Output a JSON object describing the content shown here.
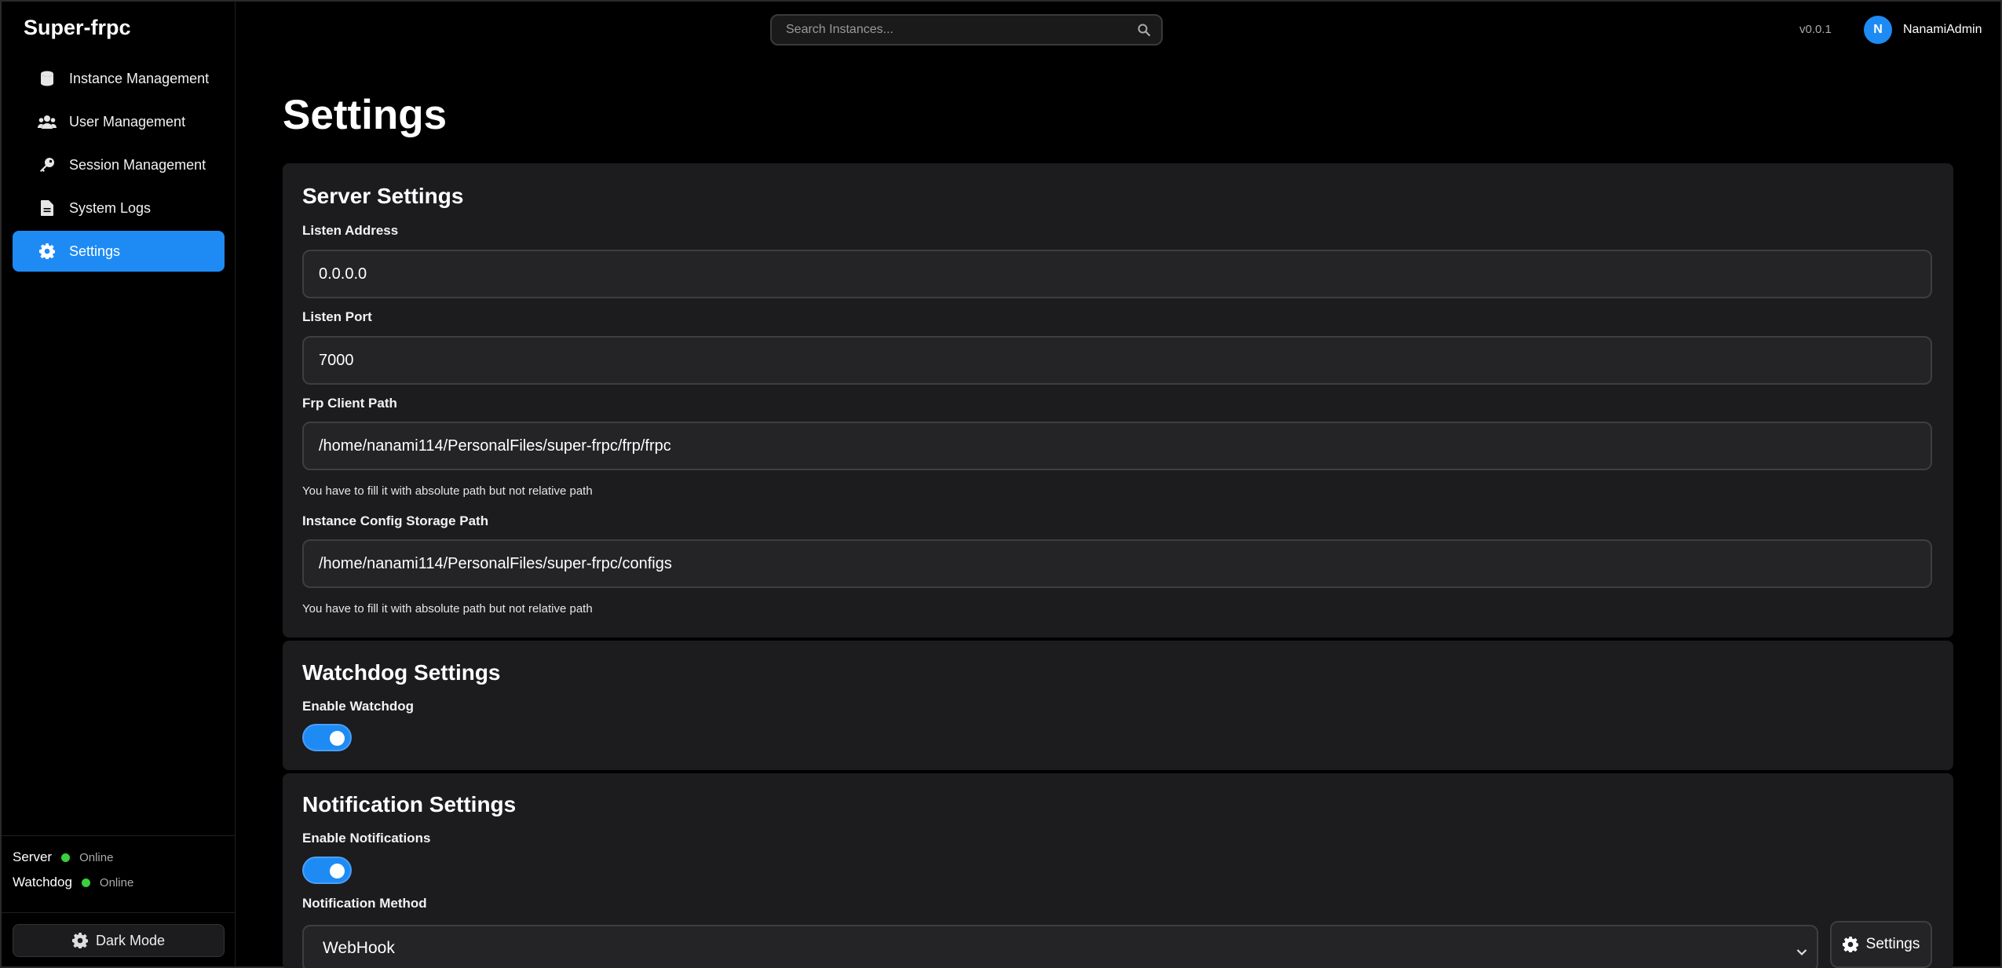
{
  "brand": "Super-frpc",
  "sidebar": {
    "items": [
      {
        "label": "Instance Management",
        "icon": "database-icon"
      },
      {
        "label": "User Management",
        "icon": "users-icon"
      },
      {
        "label": "Session Management",
        "icon": "key-icon"
      },
      {
        "label": "System Logs",
        "icon": "file-icon"
      },
      {
        "label": "Settings",
        "icon": "gear-icon",
        "active": true
      }
    ],
    "status": {
      "server_label": "Server",
      "server_value": "Online",
      "watchdog_label": "Watchdog",
      "watchdog_value": "Online"
    },
    "dark_mode_label": "Dark Mode"
  },
  "header": {
    "search_placeholder": "Search Instances...",
    "version": "v0.0.1",
    "avatar_initial": "N",
    "username": "NanamiAdmin"
  },
  "page": {
    "title": "Settings",
    "server": {
      "title": "Server Settings",
      "listen_address_label": "Listen Address",
      "listen_address_value": "0.0.0.0",
      "listen_port_label": "Listen Port",
      "listen_port_value": "7000",
      "frp_client_path_label": "Frp Client Path",
      "frp_client_path_value": "/home/nanami114/PersonalFiles/super-frpc/frp/frpc",
      "frp_client_path_hint": "You have to fill it with absolute path but not relative path",
      "config_storage_label": "Instance Config Storage Path",
      "config_storage_value": "/home/nanami114/PersonalFiles/super-frpc/configs",
      "config_storage_hint": "You have to fill it with absolute path but not relative path"
    },
    "watchdog": {
      "title": "Watchdog Settings",
      "enable_label": "Enable Watchdog",
      "enabled": true
    },
    "notification": {
      "title": "Notification Settings",
      "enable_label": "Enable Notifications",
      "enabled": true,
      "method_label": "Notification Method",
      "method_value": "WebHook",
      "settings_button": "Settings"
    }
  },
  "colors": {
    "accent": "#1e8bf5",
    "status_online": "#3bcf3b",
    "card_bg": "#1c1c1e"
  }
}
